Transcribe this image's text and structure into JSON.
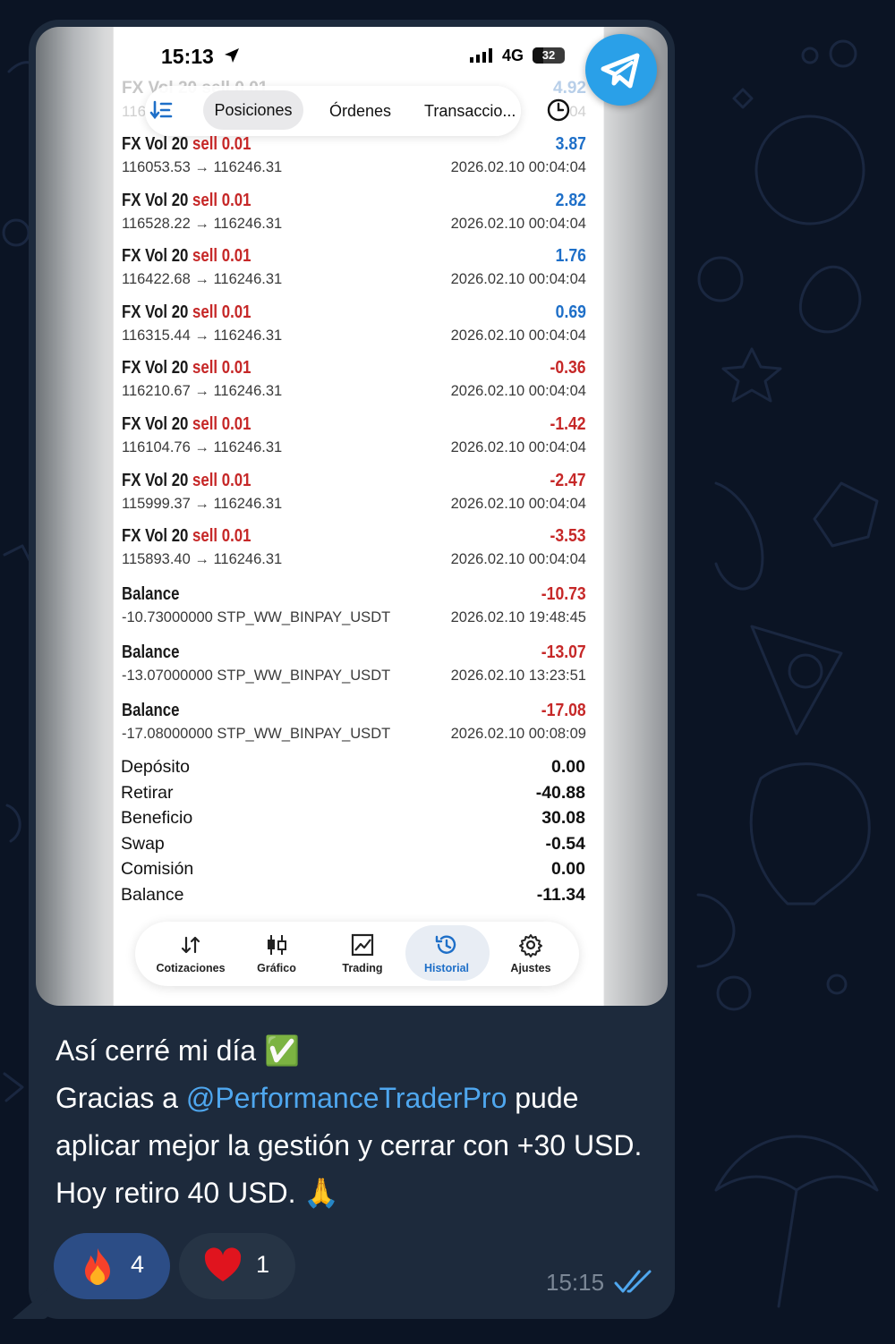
{
  "status_bar": {
    "time": "15:13",
    "network": "4G",
    "battery": "32"
  },
  "tabs": {
    "positions": "Posiciones",
    "orders": "Órdenes",
    "transactions": "Transaccio..."
  },
  "ghost_row": {
    "name": "FX Vol 20 sell 0.01",
    "profit": "4.92",
    "left_sub": "116",
    "right_sub": "0 0",
    "sub_end": "04"
  },
  "trades": [
    {
      "symbol": "FX Vol 20",
      "side": "sell",
      "volume": "0.01",
      "profit": "3.87",
      "prices": "116053.53 → 116246.31",
      "date": "2026.02.10 00:04:04"
    },
    {
      "symbol": "FX Vol 20",
      "side": "sell",
      "volume": "0.01",
      "profit": "2.82",
      "prices": "116528.22 → 116246.31",
      "date": "2026.02.10 00:04:04"
    },
    {
      "symbol": "FX Vol 20",
      "side": "sell",
      "volume": "0.01",
      "profit": "1.76",
      "prices": "116422.68 → 116246.31",
      "date": "2026.02.10 00:04:04"
    },
    {
      "symbol": "FX Vol 20",
      "side": "sell",
      "volume": "0.01",
      "profit": "0.69",
      "prices": "116315.44 → 116246.31",
      "date": "2026.02.10 00:04:04"
    },
    {
      "symbol": "FX Vol 20",
      "side": "sell",
      "volume": "0.01",
      "profit": "-0.36",
      "prices": "116210.67 → 116246.31",
      "date": "2026.02.10 00:04:04"
    },
    {
      "symbol": "FX Vol 20",
      "side": "sell",
      "volume": "0.01",
      "profit": "-1.42",
      "prices": "116104.76 → 116246.31",
      "date": "2026.02.10 00:04:04"
    },
    {
      "symbol": "FX Vol 20",
      "side": "sell",
      "volume": "0.01",
      "profit": "-2.47",
      "prices": "115999.37 → 116246.31",
      "date": "2026.02.10 00:04:04"
    },
    {
      "symbol": "FX Vol 20",
      "side": "sell",
      "volume": "0.01",
      "profit": "-3.53",
      "prices": "115893.40 → 116246.31",
      "date": "2026.02.10 00:04:04"
    }
  ],
  "balances": [
    {
      "label": "Balance",
      "amount": "-10.73",
      "detail": "-10.73000000 STP_WW_BINPAY_USDT",
      "date": "2026.02.10 19:48:45"
    },
    {
      "label": "Balance",
      "amount": "-13.07",
      "detail": "-13.07000000 STP_WW_BINPAY_USDT",
      "date": "2026.02.10 13:23:51"
    },
    {
      "label": "Balance",
      "amount": "-17.08",
      "detail": "-17.08000000 STP_WW_BINPAY_USDT",
      "date": "2026.02.10 00:08:09"
    }
  ],
  "summary": [
    {
      "label": "Depósito",
      "value": "0.00"
    },
    {
      "label": "Retirar",
      "value": "-40.88"
    },
    {
      "label": "Beneficio",
      "value": "30.08"
    },
    {
      "label": "Swap",
      "value": "-0.54"
    },
    {
      "label": "Comisión",
      "value": "0.00"
    },
    {
      "label": "Balance",
      "value": "-11.34"
    }
  ],
  "nav": [
    {
      "label": "Cotizaciones",
      "icon": "arrows-updown-icon"
    },
    {
      "label": "Gráfico",
      "icon": "candles-icon"
    },
    {
      "label": "Trading",
      "icon": "chart-line-icon"
    },
    {
      "label": "Historial",
      "icon": "history-icon",
      "active": true
    },
    {
      "label": "Ajustes",
      "icon": "gear-icon"
    }
  ],
  "message": {
    "line1": "Así cerré mi día ✅",
    "line2_pre": "Gracias a ",
    "mention": "@PerformanceTraderPro",
    "line2_post": " pude",
    "line3": "aplicar mejor la gestión y cerrar con +30 USD.",
    "line4": "Hoy retiro 40 USD. 🙏",
    "time": "15:15"
  },
  "reactions": [
    {
      "emoji": "🔥",
      "count": "4"
    },
    {
      "emoji": "❤️",
      "count": "1"
    }
  ],
  "colors": {
    "profit_positive": "#1e6fc8",
    "profit_negative": "#c62828",
    "link": "#4fa7ef",
    "bubble": "#1d2a3c",
    "telegram_blue": "#2aa0e8"
  }
}
